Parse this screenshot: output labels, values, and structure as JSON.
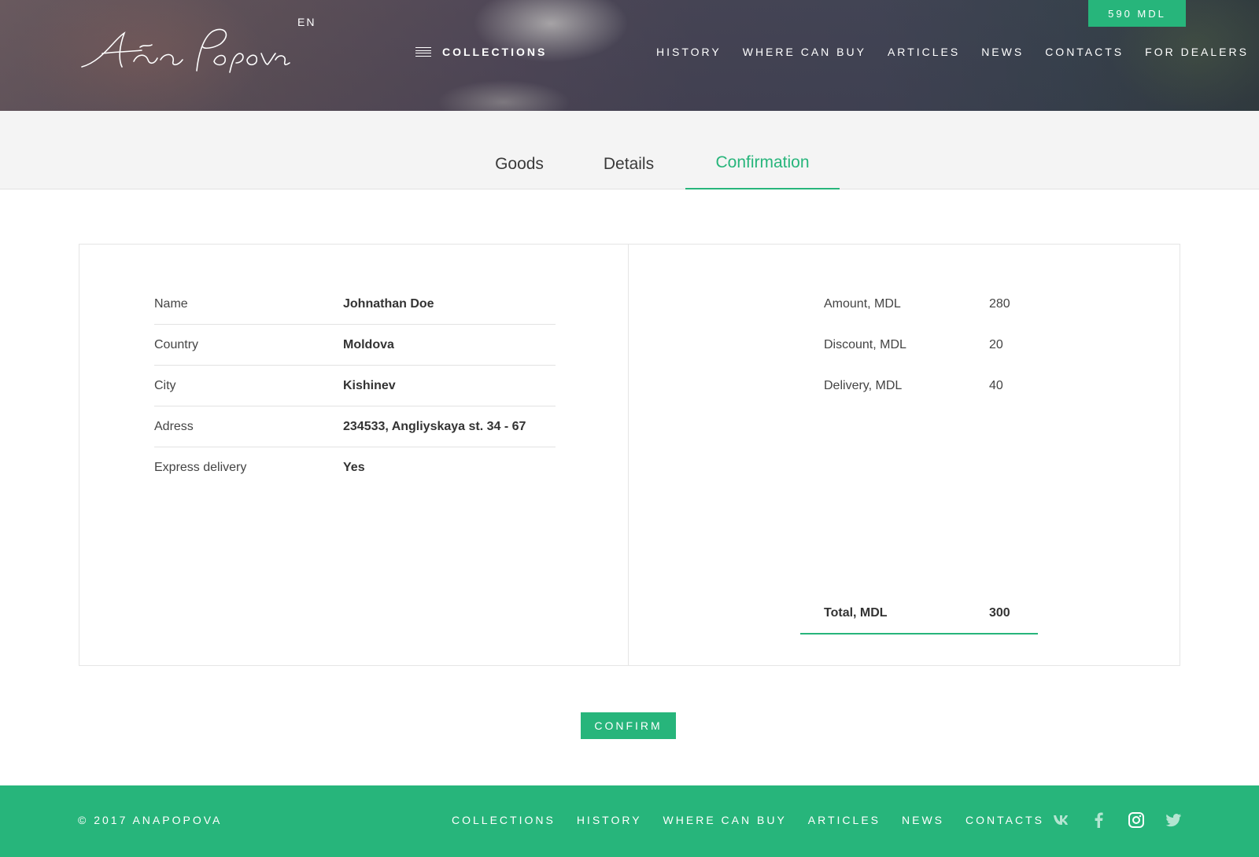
{
  "header": {
    "logo_text": "Aña Popova",
    "language": "EN",
    "collections_label": "COLLECTIONS",
    "nav": [
      "HISTORY",
      "WHERE CAN BUY",
      "ARTICLES",
      "NEWS",
      "CONTACTS",
      "FOR DEALERS"
    ],
    "cart_total": "590 MDL"
  },
  "tabs": {
    "goods": "Goods",
    "details": "Details",
    "confirmation": "Confirmation",
    "active": "confirmation"
  },
  "customer": {
    "rows": [
      {
        "label": "Name",
        "value": "Johnathan Doe"
      },
      {
        "label": "Country",
        "value": "Moldova"
      },
      {
        "label": "City",
        "value": "Kishinev"
      },
      {
        "label": "Adress",
        "value": "234533, Angliyskaya st. 34 - 67"
      },
      {
        "label": "Express delivery",
        "value": "Yes"
      }
    ]
  },
  "totals": {
    "rows": [
      {
        "label": "Amount, MDL",
        "value": "280"
      },
      {
        "label": "Discount, MDL",
        "value": "20"
      },
      {
        "label": "Delivery, MDL",
        "value": "40"
      }
    ],
    "total_label": "Total, MDL",
    "total_value": "300"
  },
  "actions": {
    "confirm_label": "CONFIRM"
  },
  "footer": {
    "copyright": "© 2017  ANAPOPOVA",
    "nav": [
      "COLLECTIONS",
      "HISTORY",
      "WHERE CAN BUY",
      "ARTICLES",
      "NEWS",
      "CONTACTS"
    ],
    "socials": [
      "vk-icon",
      "facebook-icon",
      "instagram-icon",
      "twitter-icon"
    ]
  },
  "colors": {
    "accent": "#27b57b",
    "tabs_background": "#f4f4f4",
    "text": "#333333"
  }
}
